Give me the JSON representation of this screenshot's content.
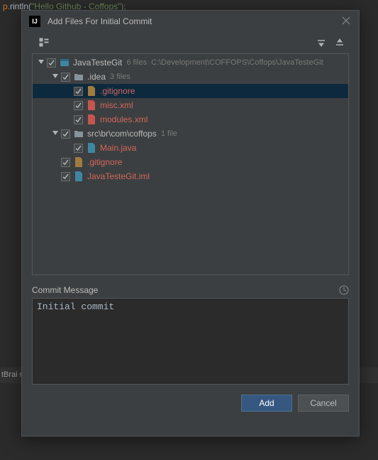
{
  "bg_code_fragment": "\"Hello Github - Coffops\");",
  "bg_status": "tBrai                                                                n  File",
  "dialog": {
    "title": "Add Files For Initial Commit"
  },
  "tree": {
    "root": {
      "name": "JavaTesteGit",
      "meta_count": "6 files",
      "meta_path": "C:\\Development\\COFFOPS\\Coffops\\JavaTesteGit",
      "children": [
        {
          "name": ".idea",
          "type": "folder",
          "meta_count": "3 files",
          "children": [
            {
              "name": ".gitignore",
              "type": "file-new",
              "selected": true
            },
            {
              "name": "misc.xml",
              "type": "file-new"
            },
            {
              "name": "modules.xml",
              "type": "file-new"
            }
          ]
        },
        {
          "name": "src\\br\\com\\coffops",
          "type": "folder",
          "meta_count": "1 file",
          "children": [
            {
              "name": "Main.java",
              "type": "file-new"
            }
          ]
        },
        {
          "name": ".gitignore",
          "type": "file-new-root"
        },
        {
          "name": "JavaTesteGit.iml",
          "type": "file-new-root"
        }
      ]
    }
  },
  "commit": {
    "label": "Commit Message",
    "message": "Initial commit"
  },
  "buttons": {
    "add": "Add",
    "cancel": "Cancel"
  }
}
